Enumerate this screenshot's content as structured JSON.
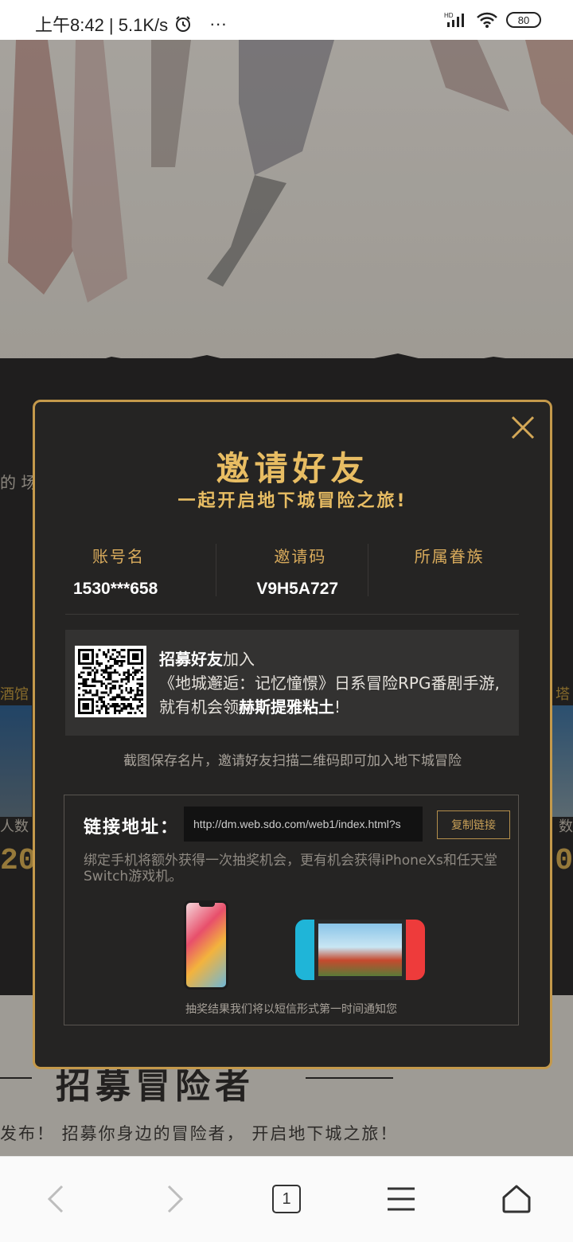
{
  "status_bar": {
    "time_speed": "上午8:42 | 5.1K/s",
    "more": "···",
    "signal_badge": "HD",
    "battery": "80"
  },
  "background": {
    "side_text_left": "的 场",
    "tavern_label": "酒馆",
    "tower_label": "塔",
    "stat_left_text": "人数",
    "stat_right_text": "数",
    "stat_left_num": "20",
    "stat_right_num": "0",
    "heading": "招募冒险者",
    "subline": "发布！ 招募你身边的冒险者， 开启地下城之旅！"
  },
  "modal": {
    "title": "邀请好友",
    "subtitle": "一起开启地下城冒险之旅!",
    "columns": [
      {
        "label": "账号名",
        "value": "1530***658"
      },
      {
        "label": "邀请码",
        "value": "V9H5A727"
      },
      {
        "label": "所属眷族",
        "value": ""
      }
    ],
    "promo": {
      "line1_bold": "招募好友",
      "line1_rest": "加入",
      "line2": "《地城邂逅：记忆憧憬》日系冒险RPG番剧手游,",
      "line3_prefix": "就有机会领",
      "line3_bold": "赫斯提雅粘土",
      "line3_suffix": "!"
    },
    "caption": "截图保存名片，邀请好友扫描二维码即可加入地下城冒险",
    "link": {
      "label": "链接地址：",
      "url": "http://dm.web.sdo.com/web1/index.html?s",
      "copy_button": "复制链接",
      "description": "绑定手机将额外获得一次抽奖机会，更有机会获得iPhoneXs和任天堂Switch游戏机。",
      "prize_note": "抽奖结果我们将以短信形式第一时间通知您"
    }
  },
  "nav": {
    "tab_count": "1"
  },
  "colors": {
    "gold": "#e8bd63",
    "modal_bg": "#252423",
    "modal_border": "#c4994b"
  }
}
